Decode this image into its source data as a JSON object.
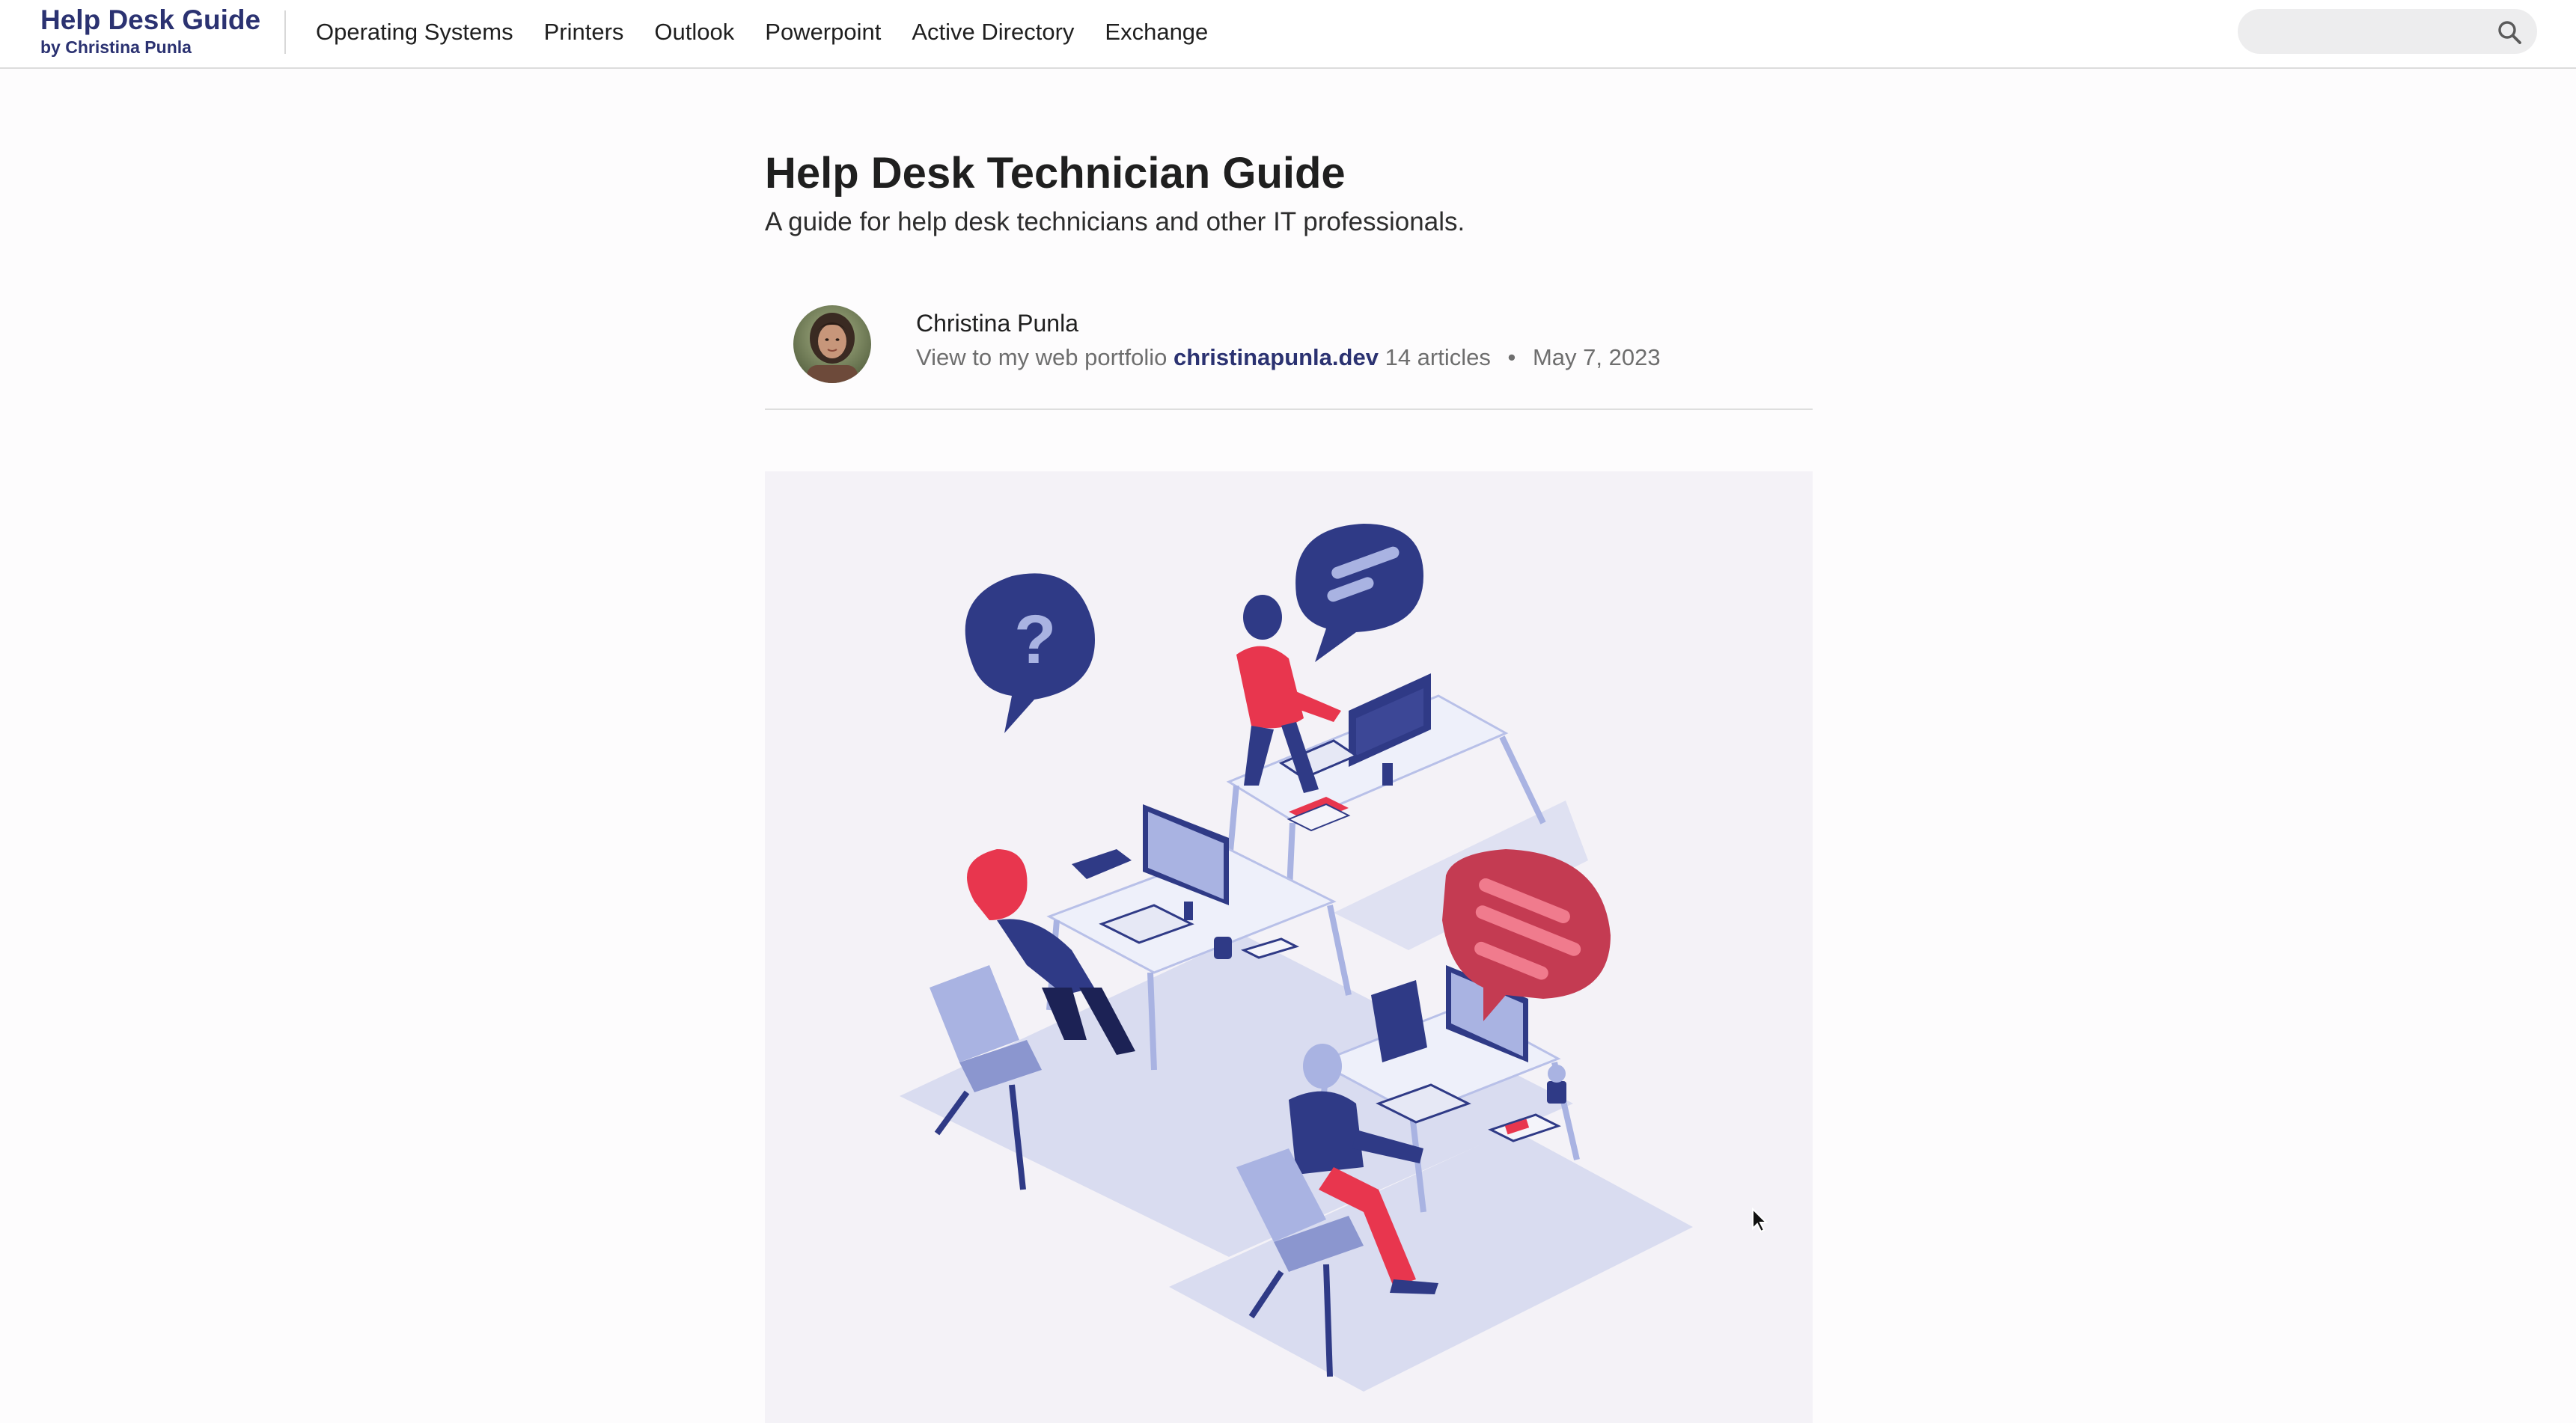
{
  "brand": {
    "title": "Help Desk Guide",
    "subtitle": "by Christina Punla"
  },
  "nav": {
    "items": [
      {
        "label": "Operating Systems"
      },
      {
        "label": "Printers"
      },
      {
        "label": "Outlook"
      },
      {
        "label": "Powerpoint"
      },
      {
        "label": "Active Directory"
      },
      {
        "label": "Exchange"
      }
    ]
  },
  "search": {
    "placeholder": "",
    "icon": "search-icon"
  },
  "article": {
    "title": "Help Desk Technician Guide",
    "subtitle": "A guide for help desk technicians and other IT professionals.",
    "author": {
      "name": "Christina Punla",
      "bio": "View to my web portfolio",
      "link_text": "christinapunla.dev",
      "article_count": "14 articles",
      "separator": "•",
      "date": "May 7, 2023"
    },
    "hero_image": {
      "description_icon": "help-desk-office-illustration"
    }
  },
  "colors": {
    "brand": "#2b3271",
    "accent_red": "#e8364e",
    "navy": "#2f3a86",
    "lavender": "#a9b3e2",
    "hero_bg": "#f4f2f7"
  }
}
